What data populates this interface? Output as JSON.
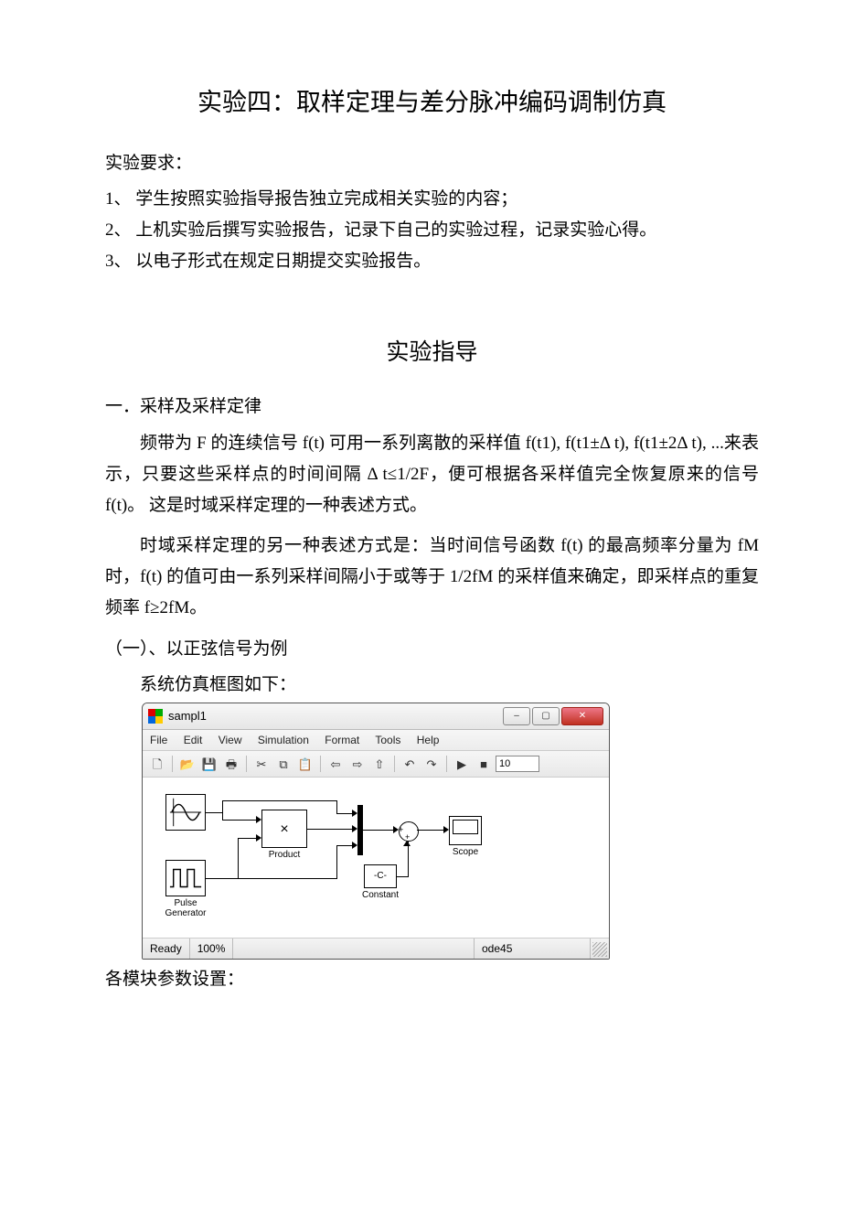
{
  "title": "实验四：取样定理与差分脉冲编码调制仿真",
  "req_heading": "实验要求：",
  "requirements": [
    "1、 学生按照实验指导报告独立完成相关实验的内容；",
    "2、 上机实验后撰写实验报告，记录下自己的实验过程，记录实验心得。",
    "3、 以电子形式在规定日期提交实验报告。"
  ],
  "guide_title": "实验指导",
  "section1_heading": "一．采样及采样定律",
  "para1": "频带为 F 的连续信号 f(t) 可用一系列离散的采样值 f(t1), f(t1±Δ t), f(t1±2Δ t), ...来表示，只要这些采样点的时间间隔 Δ t≤1/2F，便可根据各采样值完全恢复原来的信号 f(t)。 这是时域采样定理的一种表述方式。",
  "para2": "时域采样定理的另一种表述方式是：当时间信号函数 f(t) 的最高频率分量为 fM 时，f(t) 的值可由一系列采样间隔小于或等于 1/2fM 的采样值来确定，即采样点的重复频率 f≥2fM。",
  "subsection": "（一）、以正弦信号为例",
  "fig_intro": "系统仿真框图如下：",
  "ending": "各模块参数设置：",
  "sim": {
    "window_title": "sampl1",
    "menu": {
      "file": "File",
      "edit": "Edit",
      "view": "View",
      "simulation": "Simulation",
      "format": "Format",
      "tools": "Tools",
      "help": "Help"
    },
    "toolbar": {
      "new": "🗋",
      "open": "📂",
      "save": "💾",
      "print": "🖶",
      "cut": "✂",
      "copy": "⧉",
      "paste": "📋",
      "back": "⇦",
      "fwd": "⇨",
      "up": "⇧",
      "undo": "↶",
      "redo": "↷",
      "run": "▶",
      "stop": "■",
      "time": "10"
    },
    "blocks": {
      "product": "Product",
      "product_sym": "×",
      "pulse": "Pulse\nGenerator",
      "constant": "Constant",
      "constant_sym": "-C-",
      "scope": "Scope"
    },
    "status": {
      "ready": "Ready",
      "zoom": "100%",
      "solver": "ode45"
    }
  }
}
